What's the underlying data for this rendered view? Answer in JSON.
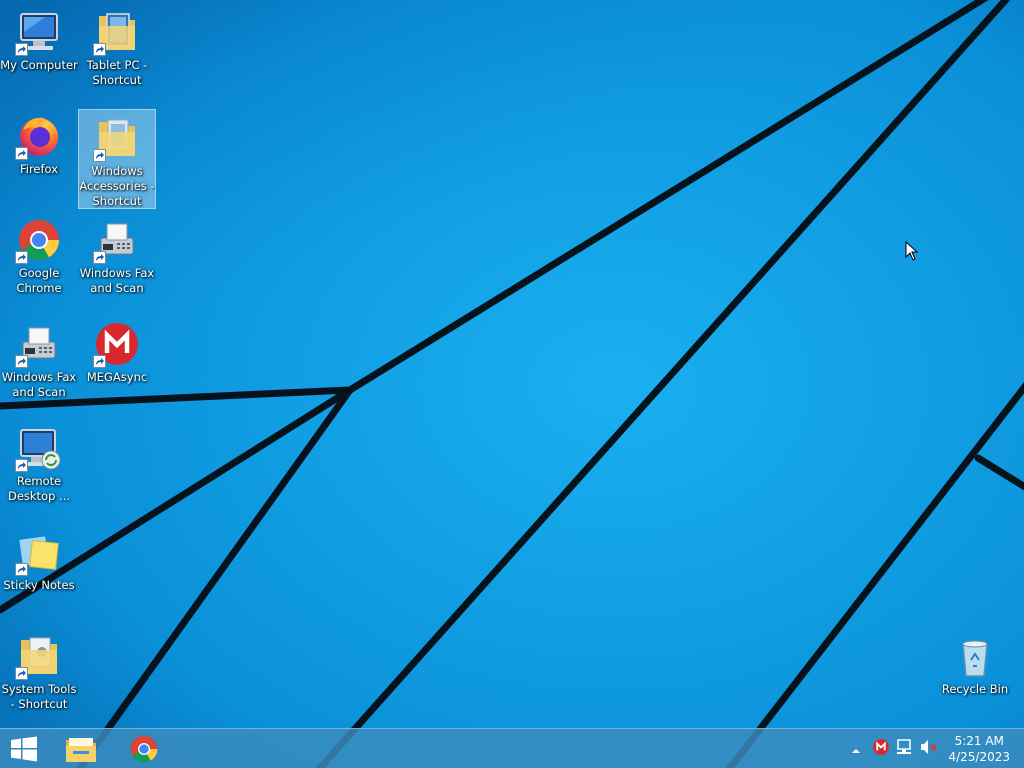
{
  "desktop": {
    "icons": [
      {
        "label": "My Computer",
        "icon": "computer-icon"
      },
      {
        "label": "Tablet PC -\nShortcut",
        "icon": "folder-icon"
      },
      {
        "label": "Firefox",
        "icon": "firefox-icon"
      },
      {
        "label": "Windows\nAccessories -\nShortcut",
        "icon": "folder-icon"
      },
      {
        "label": "Google\nChrome",
        "icon": "chrome-icon"
      },
      {
        "label": "Windows Fax\nand Scan",
        "icon": "fax-icon"
      },
      {
        "label": "Windows Fax\nand Scan",
        "icon": "fax-icon"
      },
      {
        "label": "MEGAsync",
        "icon": "mega-icon"
      },
      {
        "label": "Remote\nDesktop ...",
        "icon": "remote-desktop-icon"
      },
      {
        "label": "Sticky Notes",
        "icon": "sticky-notes-icon"
      },
      {
        "label": "System Tools\n- Shortcut",
        "icon": "folder-icon"
      },
      {
        "label": "Recycle Bin",
        "icon": "recycle-bin-icon"
      }
    ]
  },
  "taskbar": {
    "clock": {
      "time": "5:21 AM",
      "date": "4/25/2023"
    },
    "pinned": [
      "file-explorer-icon",
      "chrome-icon"
    ],
    "tray": [
      "show-hidden-icons-chevron",
      "mega-tray-icon",
      "network-icon",
      "volume-muted-icon"
    ]
  },
  "colors": {
    "wallpaper": "#0a8fd8",
    "taskbar": "#3c8cbe",
    "mega_red": "#d9272e"
  }
}
